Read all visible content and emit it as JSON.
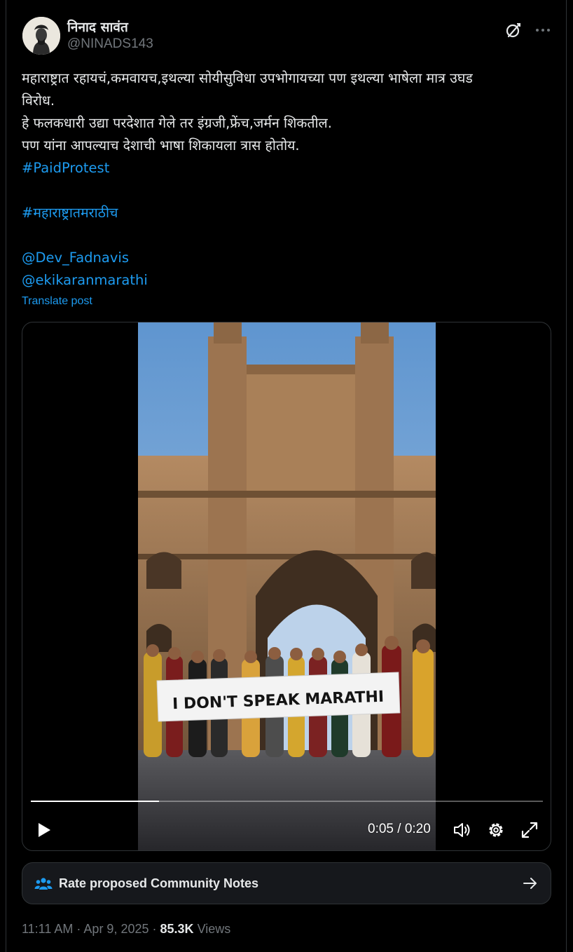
{
  "author": {
    "name": "निनाद सावंत",
    "handle": "@NINADS143"
  },
  "post": {
    "lines": [
      "महाराष्ट्रात रहायचं,कमवायच,इथल्या सोयीसुविधा उपभोगायच्या पण इथल्या भाषेला मात्र उघड",
      "विरोध.",
      "हे फलकधारी उद्या परदेशात गेले तर इंग्रजी,फ्रेंच,जर्मन शिकतील.",
      "पण यांना आपल्याच देशाची भाषा शिकायला त्रास होतोय."
    ],
    "hashtag_1": "#PaidProtest",
    "hashtag_2": "#महाराष्ट्रातमराठीच",
    "mention_1": "@Dev_Fadnavis",
    "mention_2": "@ekikaranmarathi",
    "translate_label": "Translate post"
  },
  "video": {
    "banner_text": "I  DON'T SPEAK MARATHI",
    "time": "0:05 / 0:20",
    "progress_fraction": 0.25
  },
  "community_notes": {
    "label": "Rate proposed Community Notes"
  },
  "meta": {
    "time": "11:11 AM",
    "date": "Apr 9, 2025",
    "views_count": "85.3K",
    "views_label": "Views"
  },
  "icons": {
    "grok": "grok-icon",
    "more": "more-icon",
    "play": "play-icon",
    "volume": "volume-icon",
    "settings": "settings-icon",
    "fullscreen": "fullscreen-icon",
    "notes": "people-icon",
    "arrow": "arrow-right-icon"
  },
  "colors": {
    "background": "#000000",
    "text": "#e7e9ea",
    "muted": "#71767b",
    "link": "#1d9bf0",
    "border": "#2f3336"
  }
}
